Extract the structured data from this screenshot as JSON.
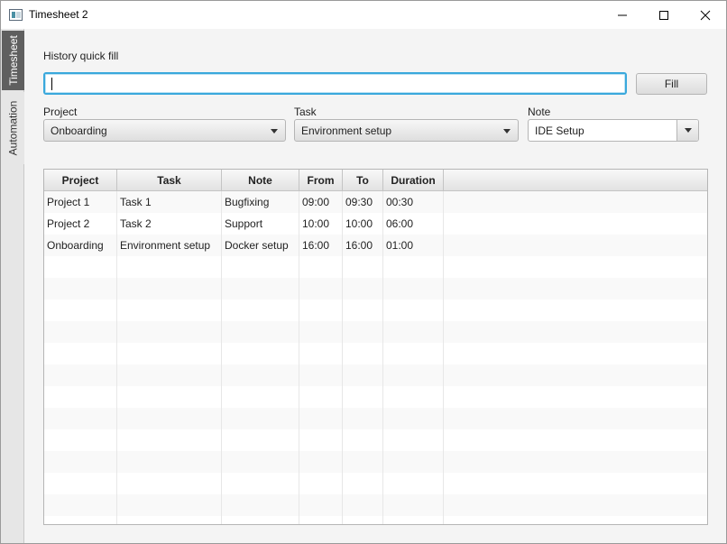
{
  "window": {
    "title": "Timesheet 2",
    "buttons": {
      "minimize": "minimize",
      "maximize": "maximize",
      "close": "close"
    }
  },
  "side_tabs": [
    {
      "label": "Timesheet",
      "selected": true
    },
    {
      "label": "Automation",
      "selected": false
    }
  ],
  "history": {
    "label": "History quick fill",
    "value": "",
    "fill_button": "Fill"
  },
  "selectors": {
    "project": {
      "label": "Project",
      "value": "Onboarding"
    },
    "task": {
      "label": "Task",
      "value": "Environment setup"
    },
    "note": {
      "label": "Note",
      "value": "IDE Setup"
    }
  },
  "table": {
    "columns": [
      "Project",
      "Task",
      "Note",
      "From",
      "To",
      "Duration"
    ],
    "rows": [
      [
        "Project 1",
        "Task 1",
        "Bugfixing",
        "09:00",
        "09:30",
        "00:30"
      ],
      [
        "Project 2",
        "Task 2",
        "Support",
        "10:00",
        "10:00",
        "06:00"
      ],
      [
        "Onboarding",
        "Environment setup",
        "Docker setup",
        "16:00",
        "16:00",
        "01:00"
      ]
    ]
  },
  "colors": {
    "focus_border": "#3aa8dc",
    "selected_tab": "#5f5f5f"
  }
}
